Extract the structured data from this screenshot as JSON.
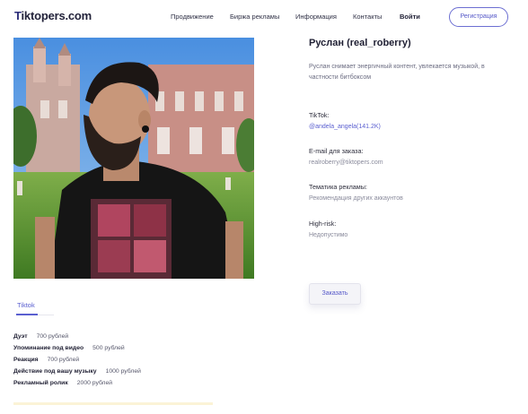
{
  "header": {
    "logo_first": "T",
    "logo_rest": "iktopers.com",
    "nav": [
      "Продвижение",
      "Биржа рекламы",
      "Информация",
      "Контакты"
    ],
    "login": "Войти",
    "register": "Регистрация"
  },
  "profile": {
    "name": "Руслан (real_roberry)",
    "description": "Руслан снимает энергичный контент, увлекается музыкой, в частности битбоксом",
    "tiktok_label": "TikTok:",
    "tiktok_value": "@andela_angela(141.2K)",
    "email_label": "E-mail для заказа:",
    "email_value": "realroberry@tiktopers.com",
    "topic_label": "Тематика рекламы:",
    "topic_value": "Рекомендация других аккаунтов",
    "risk_label": "High-risk:",
    "risk_value": "Недопустимо",
    "order_button": "Заказать"
  },
  "tabs": [
    "Tiktok"
  ],
  "prices": [
    {
      "label": "Дуэт",
      "value": "700 рублей"
    },
    {
      "label": "Упоминание под видео",
      "value": "500 рублей"
    },
    {
      "label": "Реакция",
      "value": "700 рублей"
    },
    {
      "label": "Действие под вашу музыку",
      "value": "1000 рублей"
    },
    {
      "label": "Рекламный ролик",
      "value": "2000 рублей"
    }
  ]
}
